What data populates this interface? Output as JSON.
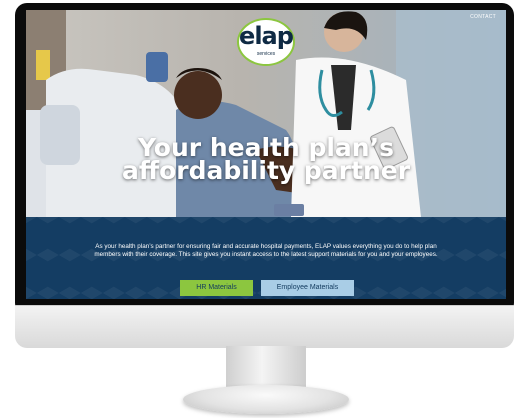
{
  "header": {
    "contact_link": "CONTACT"
  },
  "logo": {
    "wordmark": "elap",
    "subtitle": "services"
  },
  "hero": {
    "headline_line1": "Your health plan’s",
    "headline_line2": "affordability partner"
  },
  "intro": {
    "text": "As your health plan’s partner for ensuring fair and accurate hospital payments, ELAP values everything you do to help plan members with their coverage. This site gives you instant access to the latest support materials for you and your employees."
  },
  "buttons": {
    "hr_label": "HR Materials",
    "employee_label": "Employee Materials"
  },
  "colors": {
    "brand_navy": "#143d63",
    "brand_green": "#8cc63f",
    "button_light_blue": "#a9cde6"
  }
}
